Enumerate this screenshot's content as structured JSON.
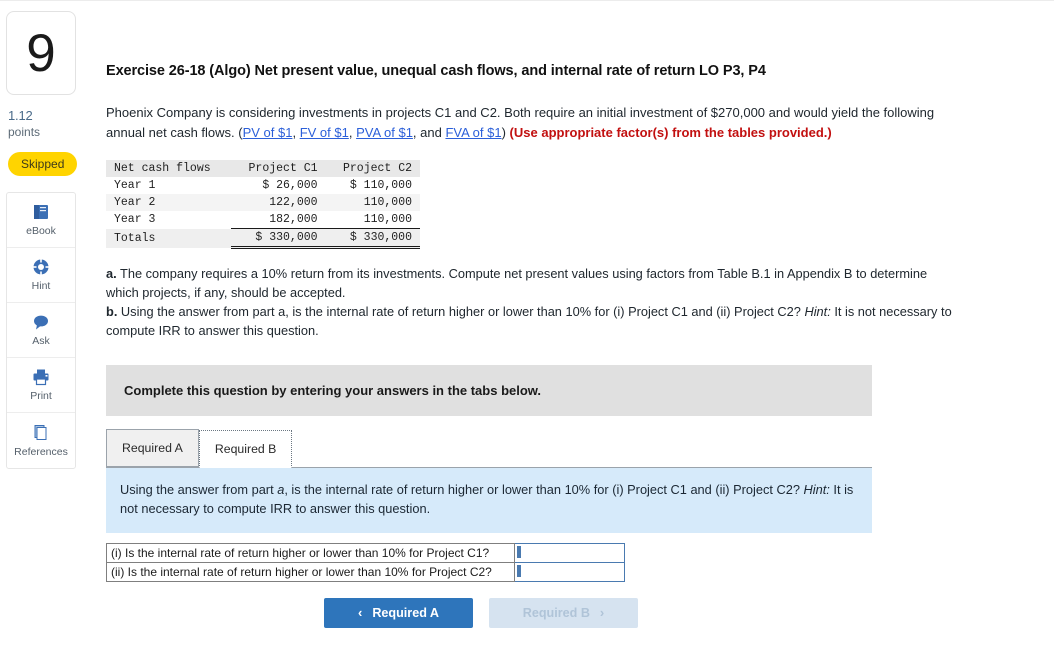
{
  "question": {
    "number": "9",
    "points_value": "1.12",
    "points_label": "points",
    "status_badge": "Skipped"
  },
  "tools": [
    {
      "name": "ebook",
      "label": "eBook",
      "icon": "book-icon"
    },
    {
      "name": "hint",
      "label": "Hint",
      "icon": "lifebuoy-icon"
    },
    {
      "name": "ask",
      "label": "Ask",
      "icon": "chat-bubble-icon"
    },
    {
      "name": "print",
      "label": "Print",
      "icon": "printer-icon"
    },
    {
      "name": "references",
      "label": "References",
      "icon": "stacked-pages-icon"
    }
  ],
  "header": {
    "title": "Exercise 26-18 (Algo) Net present value, unequal cash flows, and internal rate of return LO P3, P4"
  },
  "intro": {
    "text_1": "Phoenix Company is considering investments in projects C1 and C2. Both require an initial investment of $270,000 and would yield the following annual net cash flows. (",
    "link_1": "PV of $1",
    "sep_1": ", ",
    "link_2": "FV of $1",
    "sep_2": ", ",
    "link_3": "PVA of $1",
    "sep_3": ", and ",
    "link_4": "FVA of $1",
    "text_2": ") ",
    "emphasis": "(Use appropriate factor(s) from the tables provided.)"
  },
  "cash_table": {
    "headers": [
      "Net cash flows",
      "Project C1",
      "Project C2"
    ],
    "rows": [
      {
        "label": "Year 1",
        "c1": "$ 26,000",
        "c2": "$ 110,000"
      },
      {
        "label": "Year 2",
        "c1": "122,000",
        "c2": "110,000"
      },
      {
        "label": "Year 3",
        "c1": "182,000",
        "c2": "110,000"
      }
    ],
    "totals": {
      "label": "Totals",
      "c1": "$ 330,000",
      "c2": "$ 330,000"
    }
  },
  "parts": {
    "a_marker": "a.",
    "a_text": " The company requires a 10% return from its investments. Compute net present values using factors from Table B.1 in Appendix B to determine which projects, if any, should be accepted.",
    "b_marker": "b.",
    "b_text_1": " Using the answer from part a, is the internal rate of return higher or lower than 10% for (i) Project C1 and (ii) Project C2? ",
    "b_hint_label": "Hint:",
    "b_text_2": " It is not necessary to compute IRR to answer this question."
  },
  "banner": {
    "text": "Complete this question by entering your answers in the tabs below."
  },
  "tabs": [
    {
      "label": "Required A",
      "active": false
    },
    {
      "label": "Required B",
      "active": true
    }
  ],
  "instruction": {
    "text_1": "Using the answer from part ",
    "italic_1": "a",
    "text_2": ", is the internal rate of return higher or lower than 10% for (i) Project C1 and (ii) Project C2? ",
    "italic_2": "Hint:",
    "text_3": " It is not necessary to compute IRR to answer this question."
  },
  "answer_rows": [
    {
      "question": "(i) Is the internal rate of return higher or lower than 10% for Project C1?",
      "value": "",
      "placeholder": ""
    },
    {
      "question": "(ii) Is the internal rate of return higher or lower than 10% for Project C2?",
      "value": "",
      "placeholder": ""
    }
  ],
  "nav": {
    "prev_label": "Required A",
    "prev_chevron": "‹",
    "next_label": "Required B",
    "next_chevron": "›"
  },
  "colors": {
    "accent_blue": "#2e75bb",
    "link_blue": "#2b5fd9",
    "emphasis_red": "#c21010",
    "badge_yellow": "#ffd400",
    "banner_grey": "#e0e0e0",
    "instruction_blue": "#d6eafa",
    "input_border_blue": "#4a7ab0"
  }
}
